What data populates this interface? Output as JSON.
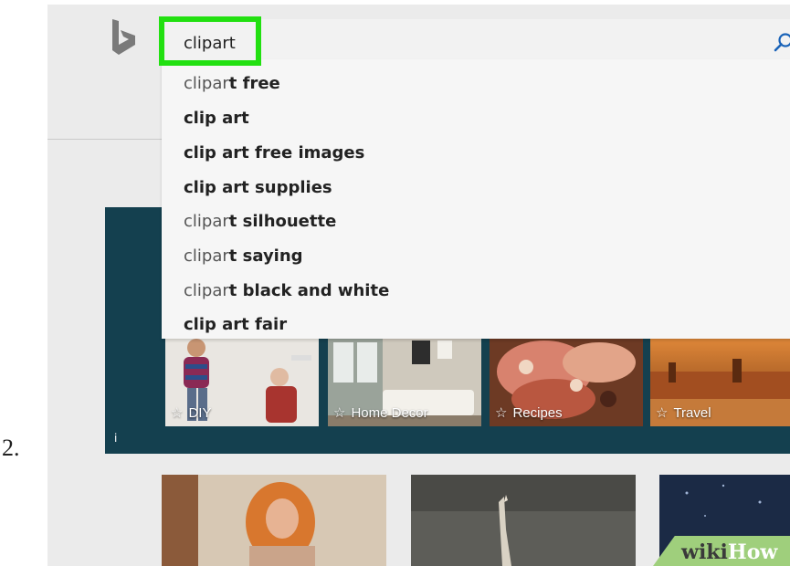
{
  "step_number": "2.",
  "search": {
    "query": "clipart"
  },
  "suggestions": [
    {
      "typed": "clipar",
      "rest": "t free"
    },
    {
      "typed": "",
      "rest": "clip art"
    },
    {
      "typed": "",
      "rest": "clip art free images"
    },
    {
      "typed": "",
      "rest": "clip art supplies"
    },
    {
      "typed": "clipar",
      "rest": "t silhouette"
    },
    {
      "typed": "clipar",
      "rest": "t saying"
    },
    {
      "typed": "clipar",
      "rest": "t black and white"
    },
    {
      "typed": "",
      "rest": "clip art fair"
    }
  ],
  "hero": {
    "info": "i",
    "tiles": [
      {
        "label": "DIY",
        "star": "☆"
      },
      {
        "label": "Home Decor",
        "star": "☆"
      },
      {
        "label": "Recipes",
        "star": "☆"
      },
      {
        "label": "Travel",
        "star": "☆"
      }
    ]
  },
  "watermark": {
    "wiki": "wiki",
    "how": "How"
  },
  "colors": {
    "highlight": "#22e011",
    "hero_bg": "#14404f",
    "page_bg": "#ebebeb"
  }
}
